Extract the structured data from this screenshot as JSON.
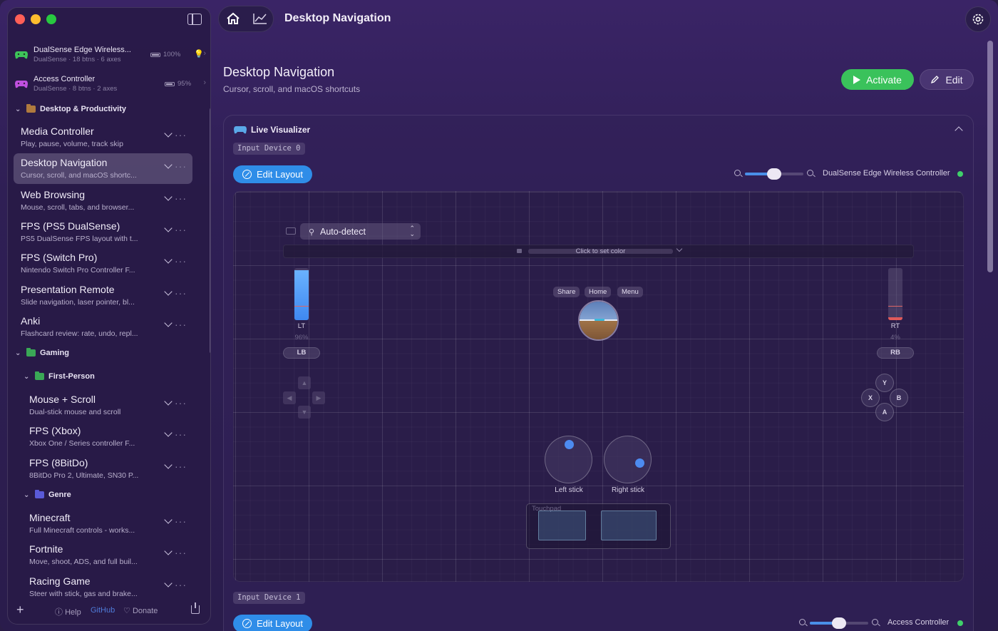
{
  "window": {
    "title": "Desktop Navigation"
  },
  "sidebar": {
    "devices": [
      {
        "name": "DualSense Edge Wireless...",
        "sub": "DualSense · 18 btns · 6 axes",
        "battery": "100%",
        "battery_level": 1.0,
        "icon_color": "#3ec45a"
      },
      {
        "name": "Access Controller",
        "sub": "DualSense · 8 btns · 2 axes",
        "battery": "95%",
        "battery_level": 0.95,
        "icon_color": "#c050e0"
      }
    ],
    "groups": {
      "desktop": "Desktop & Productivity",
      "gaming": "Gaming",
      "first_person": "First-Person",
      "genre": "Genre"
    },
    "profiles": [
      {
        "name": "Media Controller",
        "desc": "Play, pause, volume, track skip"
      },
      {
        "name": "Desktop Navigation",
        "desc": "Cursor, scroll, and macOS shortc..."
      },
      {
        "name": "Web Browsing",
        "desc": "Mouse, scroll, tabs, and browser..."
      },
      {
        "name": "FPS (PS5 DualSense)",
        "desc": "PS5 DualSense FPS layout with t..."
      },
      {
        "name": "FPS (Switch Pro)",
        "desc": "Nintendo Switch Pro Controller F..."
      },
      {
        "name": "Presentation Remote",
        "desc": "Slide navigation, laser pointer, bl..."
      },
      {
        "name": "Anki",
        "desc": "Flashcard review: rate, undo, repl..."
      },
      {
        "name": "Mouse + Scroll",
        "desc": "Dual-stick mouse and scroll"
      },
      {
        "name": "FPS (Xbox)",
        "desc": "Xbox One / Series controller F..."
      },
      {
        "name": "FPS (8BitDo)",
        "desc": "8BitDo Pro 2, Ultimate, SN30 P..."
      },
      {
        "name": "Minecraft",
        "desc": "Full Minecraft controls - works..."
      },
      {
        "name": "Fortnite",
        "desc": "Move, shoot, ADS, and full buil..."
      },
      {
        "name": "Racing Game",
        "desc": "Steer with stick, gas and brake..."
      }
    ],
    "footer": {
      "help": "Help",
      "github": "GitHub",
      "donate": "Donate"
    }
  },
  "header": {
    "title": "Desktop Navigation"
  },
  "main": {
    "title": "Desktop Navigation",
    "subtitle": "Cursor, scroll, and macOS shortcuts",
    "activate_label": "Activate",
    "edit_label": "Edit"
  },
  "visualizer": {
    "title": "Live Visualizer",
    "input0": {
      "badge": "Input Device 0",
      "edit_layout": "Edit Layout",
      "controller_name": "DualSense Edge Wireless Controller",
      "zoom_level": 0.5,
      "auto_detect": "Auto-detect",
      "color_prompt": "Click to set color",
      "lt_label": "LT",
      "lt_value": "96%",
      "lt_level": 0.96,
      "rt_label": "RT",
      "rt_value": "4%",
      "rt_level": 0.04,
      "lb": "LB",
      "rb": "RB",
      "share": "Share",
      "home": "Home",
      "menu": "Menu",
      "face": {
        "y": "Y",
        "x": "X",
        "b": "B",
        "a": "A"
      },
      "left_stick": "Left stick",
      "right_stick": "Right stick",
      "touchpad": "Touchpad"
    },
    "input1": {
      "badge": "Input Device 1",
      "edit_layout": "Edit Layout",
      "controller_name": "Access Controller",
      "zoom_level": 0.5
    }
  },
  "colors": {
    "accent_blue": "#2f8de8",
    "activate_green": "#3ac25b",
    "status_green": "#3fd06a"
  }
}
